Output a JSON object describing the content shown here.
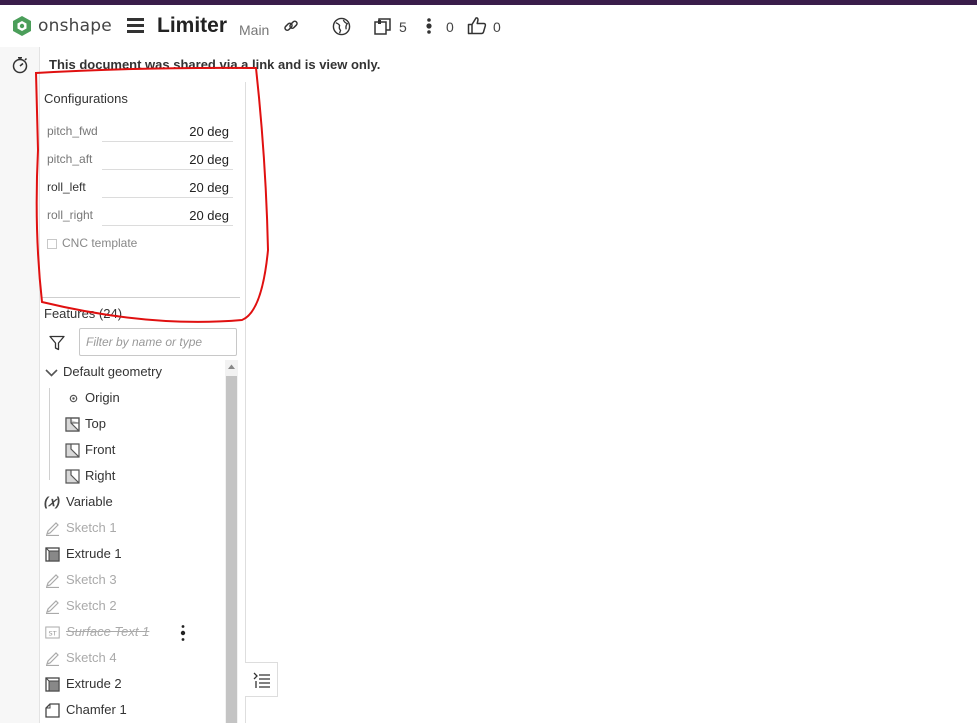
{
  "app": {
    "brand": "onshape",
    "document_title": "Limiter",
    "branch": "Main",
    "version_count": "5",
    "comment_count": "0",
    "like_count": "0"
  },
  "notice": "This document was shared via a link and is view only.",
  "configurations": {
    "title": "Configurations",
    "params": [
      {
        "name": "pitch_fwd",
        "value": "20 deg"
      },
      {
        "name": "pitch_aft",
        "value": "20 deg"
      },
      {
        "name": "roll_left",
        "value": "20 deg"
      },
      {
        "name": "roll_right",
        "value": "20 deg"
      }
    ],
    "cnc_label": "CNC template"
  },
  "features": {
    "title": "Features (24)",
    "filter_placeholder": "Filter by name or type",
    "items": [
      {
        "label": "Default geometry",
        "icon": "chevron-down-icon"
      },
      {
        "label": "Origin",
        "icon": "origin-icon"
      },
      {
        "label": "Top",
        "icon": "plane-icon"
      },
      {
        "label": "Front",
        "icon": "plane-icon"
      },
      {
        "label": "Right",
        "icon": "plane-icon"
      },
      {
        "label": "Variable",
        "icon": "variable-icon"
      },
      {
        "label": "Sketch 1",
        "icon": "sketch-icon"
      },
      {
        "label": "Extrude 1",
        "icon": "extrude-icon"
      },
      {
        "label": "Sketch 3",
        "icon": "sketch-icon"
      },
      {
        "label": "Sketch 2",
        "icon": "sketch-icon"
      },
      {
        "label": "Surface Text 1",
        "icon": "surface-text-icon"
      },
      {
        "label": "Sketch 4",
        "icon": "sketch-icon"
      },
      {
        "label": "Extrude 2",
        "icon": "extrude-icon"
      },
      {
        "label": "Chamfer 1",
        "icon": "chamfer-icon"
      }
    ]
  },
  "colors": {
    "top_stripe": "#3a1d4a",
    "logo_green": "#4b9e5a",
    "annotation_red": "#e01010"
  }
}
